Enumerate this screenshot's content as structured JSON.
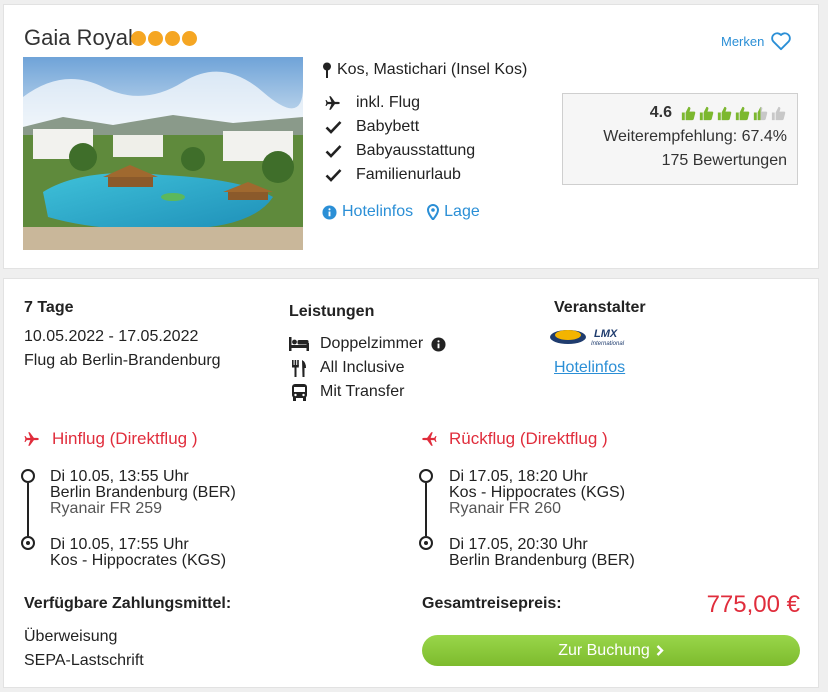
{
  "hotel": {
    "name": "Gaia Royal",
    "stars": 4,
    "star_color": "#f5a623",
    "merken_label": "Merken",
    "location": "Kos, Mastichari (Insel Kos)",
    "features": [
      {
        "icon": "plane-icon",
        "label": "inkl. Flug"
      },
      {
        "icon": "check-icon",
        "label": "Babybett"
      },
      {
        "icon": "check-icon",
        "label": "Babyausstattung"
      },
      {
        "icon": "check-icon",
        "label": "Familienurlaub"
      }
    ],
    "links": {
      "hotelinfos": "Hotelinfos",
      "lage": "Lage"
    },
    "rating": {
      "value": "4.6",
      "thumbs_filled": 4.5,
      "thumbs_total": 6,
      "recommendation": "Weiterempfehlung: 67.4%",
      "reviews": "175 Bewertungen"
    }
  },
  "offer": {
    "duration": "7 Tage",
    "dates": "10.05.2022 - 17.05.2022",
    "departure": "Flug ab Berlin-Brandenburg",
    "services_title": "Leistungen",
    "services": [
      {
        "icon": "bed-icon",
        "label": "Doppelzimmer"
      },
      {
        "icon": "cutlery-icon",
        "label": "All Inclusive"
      },
      {
        "icon": "bus-icon",
        "label": "Mit Transfer"
      }
    ],
    "operator_title": "Veranstalter",
    "operator_logo_text": "LMX",
    "operator_logo_sub": "International",
    "operator_link": "Hotelinfos"
  },
  "outbound": {
    "title": "Hinflug (Direktflug )",
    "dep_time": "Di 10.05, 13:55 Uhr",
    "dep_airport": "Berlin Brandenburg (BER)",
    "airline": "Ryanair FR 259",
    "arr_time": "Di 10.05, 17:55 Uhr",
    "arr_airport": "Kos - Hippocrates (KGS)"
  },
  "return": {
    "title": "Rückflug (Direktflug )",
    "dep_time": "Di 17.05, 18:20 Uhr",
    "dep_airport": "Kos - Hippocrates (KGS)",
    "airline": "Ryanair FR 260",
    "arr_time": "Di 17.05, 20:30 Uhr",
    "arr_airport": "Berlin Brandenburg (BER)"
  },
  "payment": {
    "title": "Verfügbare Zahlungsmittel:",
    "methods": [
      "Überweisung",
      "SEPA-Lastschrift"
    ]
  },
  "pricing": {
    "label": "Gesamtreisepreis:",
    "price": "775,00 €",
    "book_label": "Zur Buchung"
  },
  "colors": {
    "accent_blue": "#2b8fd6",
    "accent_red": "#e02d3c",
    "button_green": "#8cc63f",
    "thumb_green": "#7cb82f"
  }
}
